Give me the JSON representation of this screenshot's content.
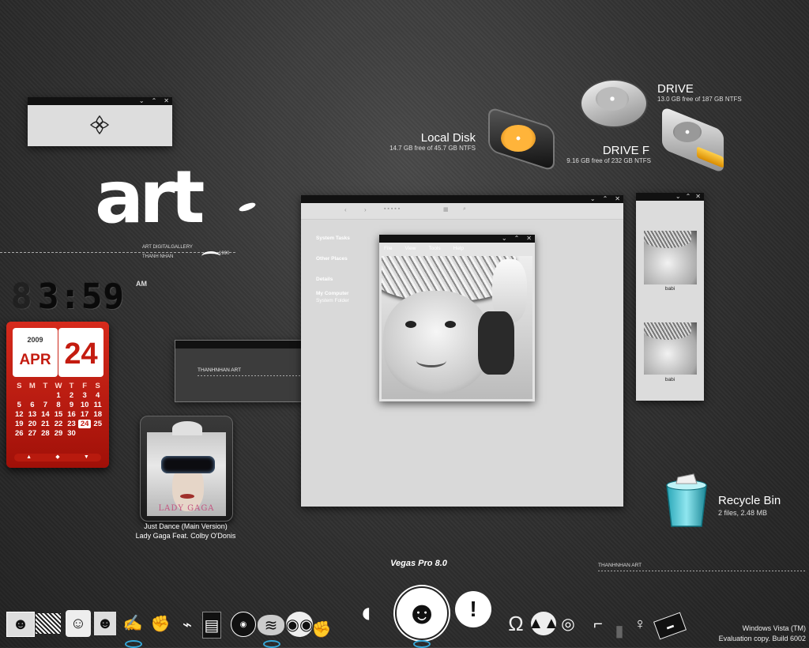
{
  "widgets": {
    "mini_window_icon": "flower-icon",
    "logo": {
      "main": "art",
      "sub1": "ART DIGITALGALLERY",
      "sub2": "THANH NHAN",
      "year": "1990"
    },
    "clock": {
      "time": "3:59",
      "ampm": "AM"
    },
    "calendar": {
      "year": "2009",
      "month": "APR",
      "day": "24",
      "weekday_headers": [
        "S",
        "M",
        "T",
        "W",
        "T",
        "F",
        "S"
      ],
      "days": [
        "",
        "",
        "",
        "1",
        "2",
        "3",
        "4",
        "5",
        "6",
        "7",
        "8",
        "9",
        "10",
        "11",
        "12",
        "13",
        "14",
        "15",
        "16",
        "17",
        "18",
        "19",
        "20",
        "21",
        "22",
        "23",
        "24",
        "25",
        "26",
        "27",
        "28",
        "29",
        "30"
      ],
      "today": "24"
    },
    "text_window": {
      "text": "THANHNHAN ART"
    },
    "media": {
      "album_text": "LADY GAGA",
      "track": "Just Dance (Main Version)",
      "artist": "Lady Gaga Feat. Colby O'Donis"
    }
  },
  "drives": {
    "local_disk": {
      "name": "Local Disk",
      "info": "14.7 GB free of 45.7 GB NTFS"
    },
    "drive": {
      "name": "DRIVE",
      "info": "13.0 GB free of 187 GB NTFS"
    },
    "drive_f": {
      "name": "DRIVE F",
      "info": "9.16 GB free of 232 GB NTFS"
    }
  },
  "explorer": {
    "sidebar": [
      "System Tasks",
      "Other Places",
      "Details"
    ],
    "details_title": "My Computer",
    "details_sub": "System Folder"
  },
  "viewer": {
    "menu": [
      "File",
      "View",
      "Tools",
      "Help"
    ]
  },
  "thumbs": {
    "items": [
      {
        "label": "babi"
      },
      {
        "label": "babi"
      }
    ]
  },
  "recycle": {
    "name": "Recycle Bin",
    "info": "2 files, 2.48 MB"
  },
  "bottom": {
    "vegas": "Vegas Pro 8.0",
    "signature": "THANHNHAN ART"
  },
  "watermark": {
    "line1": "Windows Vista (TM)",
    "line2": "Evaluation copy. Build 6002"
  },
  "dock": {
    "icons": [
      "comic-icon",
      "pattern-icon",
      "face-icon",
      "portrait-icon",
      "bird-icon",
      "hand-icon",
      "tag-icon",
      "speaker-icon",
      "badge-icon",
      "brain-icon",
      "glasses-icon",
      "fist-icon",
      "bird-large-icon",
      "girl-avatar-icon",
      "exclamation-bubble-icon",
      "horseshoe-icon",
      "pumpkin-icon",
      "owl-icon",
      "gun-icon",
      "road-icon",
      "woman-icon",
      "sign-icon"
    ]
  }
}
